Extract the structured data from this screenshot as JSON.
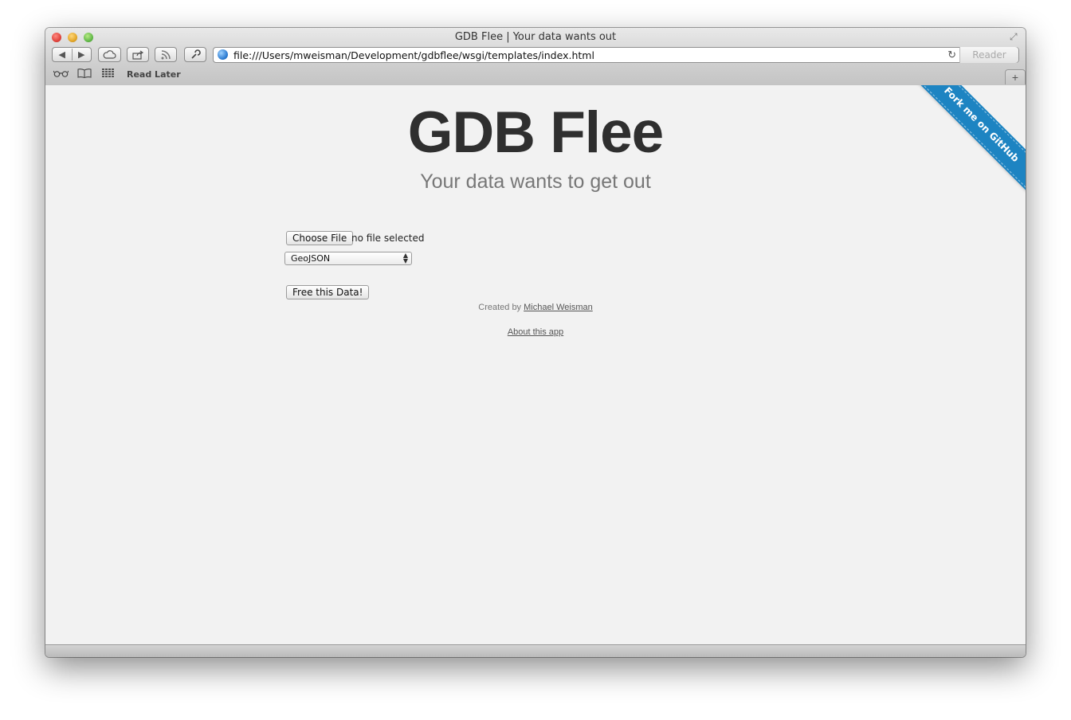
{
  "window": {
    "title": "GDB Flee | Your data wants out"
  },
  "toolbar": {
    "back_icon": "◀",
    "forward_icon": "▶",
    "url": "file:///Users/mweisman/Development/gdbflee/wsgi/templates/index.html",
    "reader_label": "Reader"
  },
  "bookmarks": {
    "read_later_label": "Read Later"
  },
  "page": {
    "title": "GDB Flee",
    "subtitle": "Your data wants to get out",
    "file_button_label": "Choose File",
    "file_status": "no file selected",
    "format_selected": "GeoJSON",
    "submit_label": "Free this Data!",
    "created_by_prefix": "Created by",
    "author_name": "Michael Weisman",
    "about_link": "About this app",
    "ribbon_text": "Fork me on GitHub"
  },
  "colors": {
    "ribbon": "#1d84c2",
    "title": "#2f2f2f",
    "subtitle": "#777777",
    "background": "#f2f2f2"
  }
}
